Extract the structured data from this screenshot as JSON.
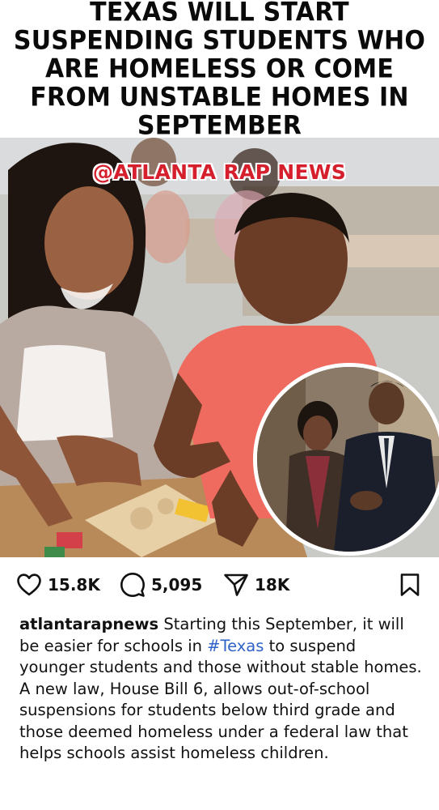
{
  "headline": {
    "text": "TEXAS WILL START SUSPENDING STUDENTS WHO ARE HOMELESS OR COME FROM UNSTABLE HOMES IN SEPTEMBER"
  },
  "image": {
    "watermark": "@ATLANTA RAP NEWS"
  },
  "actions": {
    "likes": "15.8K",
    "comments": "5,095",
    "shares": "18K"
  },
  "caption": {
    "username": "atlantarapnews",
    "text_before": " Starting this September, it will be easier for schools in ",
    "hashtag": "#Texas",
    "text_after": " to suspend younger students and those without stable homes. A new law, House Bill 6, allows out-of-school suspensions for students below third grade and those deemed homeless under a federal law that helps schools assist homeless children."
  },
  "icons": {
    "like": "heart-icon",
    "comment": "comment-bubble-icon",
    "share": "paper-plane-icon",
    "save": "bookmark-icon"
  },
  "colors": {
    "watermark": "#d61f2c",
    "hashtag": "#2f63c8"
  }
}
